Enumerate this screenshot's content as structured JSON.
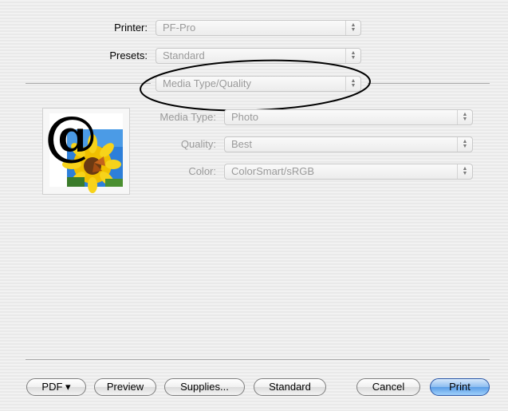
{
  "printer": {
    "label": "Printer:",
    "value": "PF-Pro"
  },
  "presets": {
    "label": "Presets:",
    "value": "Standard"
  },
  "panel": {
    "value": "Media Type/Quality"
  },
  "settings": {
    "media_type": {
      "label": "Media Type:",
      "value": "Photo"
    },
    "quality": {
      "label": "Quality:",
      "value": "Best"
    },
    "color": {
      "label": "Color:",
      "value": "ColorSmart/sRGB"
    }
  },
  "buttons": {
    "pdf": "PDF ▾",
    "preview": "Preview",
    "supplies": "Supplies...",
    "standard": "Standard",
    "cancel": "Cancel",
    "print": "Print"
  },
  "thumbnail": {
    "glyph": "@"
  },
  "colors": {
    "accent": "#5b9de6",
    "disabled_text": "#9a9a9a"
  }
}
